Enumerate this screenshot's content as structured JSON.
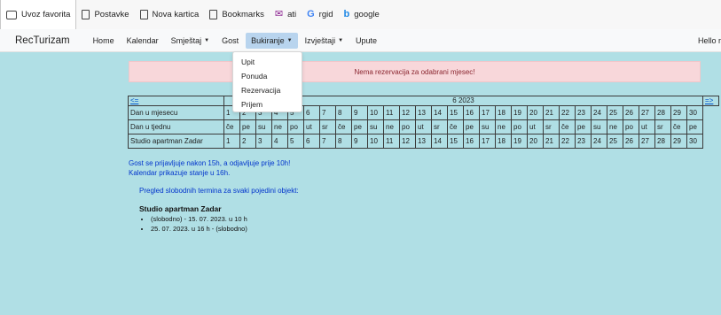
{
  "bookmarks": [
    {
      "label": "Uvoz favorita",
      "icon": "favorites-import-icon"
    },
    {
      "label": "Postavke",
      "icon": "page-icon"
    },
    {
      "label": "Nova kartica",
      "icon": "page-icon"
    },
    {
      "label": "Bookmarks",
      "icon": "page-icon"
    },
    {
      "label": "ati",
      "icon": "mail-icon"
    },
    {
      "label": "rgid",
      "icon": "google-icon"
    },
    {
      "label": "google",
      "icon": "bing-icon"
    }
  ],
  "navbar": {
    "brand": "RecTurizam",
    "items": [
      {
        "label": "Home"
      },
      {
        "label": "Kalendar"
      },
      {
        "label": "Smještaj"
      },
      {
        "label": "Gost"
      },
      {
        "label": "Bukiranje"
      },
      {
        "label": "Izvještaji"
      },
      {
        "label": "Upute"
      }
    ],
    "greeting": "Hello r"
  },
  "dropdown": {
    "items": [
      {
        "label": "Upit"
      },
      {
        "label": "Ponuda"
      },
      {
        "label": "Rezervacija"
      },
      {
        "label": "Prijem"
      }
    ]
  },
  "alert": {
    "text": "Nema rezervacija za odabrani mjesec!"
  },
  "calendar": {
    "prev": "<=",
    "next": "=>",
    "month_label": "6 2023",
    "row_day_label": "Dan u mjesecu",
    "row_weekday_label": "Dan u tjednu",
    "row_object_label": "Studio apartman Zadar",
    "days": [
      "1",
      "2",
      "3",
      "4",
      "5",
      "6",
      "7",
      "8",
      "9",
      "10",
      "11",
      "12",
      "13",
      "14",
      "15",
      "16",
      "17",
      "18",
      "19",
      "20",
      "21",
      "22",
      "23",
      "24",
      "25",
      "26",
      "27",
      "28",
      "29",
      "30"
    ],
    "weekdays": [
      "če",
      "pe",
      "su",
      "ne",
      "po",
      "ut",
      "sr",
      "če",
      "pe",
      "su",
      "ne",
      "po",
      "ut",
      "sr",
      "če",
      "pe",
      "su",
      "ne",
      "po",
      "ut",
      "sr",
      "če",
      "pe",
      "su",
      "ne",
      "po",
      "ut",
      "sr",
      "če",
      "pe"
    ],
    "object_days": [
      "1",
      "2",
      "3",
      "4",
      "5",
      "6",
      "7",
      "8",
      "9",
      "10",
      "11",
      "12",
      "13",
      "14",
      "15",
      "16",
      "17",
      "18",
      "19",
      "20",
      "21",
      "22",
      "23",
      "24",
      "25",
      "26",
      "27",
      "28",
      "29",
      "30"
    ]
  },
  "notes": {
    "line1": "Gost se prijavljuje nakon 15h, a odjavljuje prije 10h!",
    "line2": "Kalendar prikazuje stanje u 16h."
  },
  "pregled": {
    "text": "Pregled slobodnih termina za svaki pojedini objekt:"
  },
  "object": {
    "title": "Studio apartman Zadar",
    "terms": [
      "(slobodno) - 15. 07. 2023. u 10 h",
      "25. 07. 2023. u 16 h - (slobodno)"
    ]
  }
}
